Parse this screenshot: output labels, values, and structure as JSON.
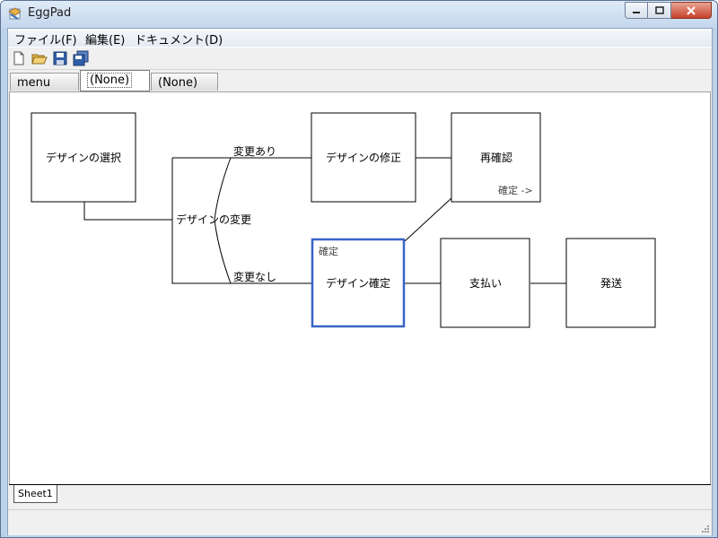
{
  "window": {
    "title": "EggPad"
  },
  "menu": {
    "file": "ファイル(F)",
    "edit": "編集(E)",
    "document": "ドキュメント(D)"
  },
  "tabs": [
    {
      "label": "menu"
    },
    {
      "label": "(None)"
    },
    {
      "label": "(None)"
    }
  ],
  "diagram": {
    "select_design": "デザインの選択",
    "change_design": "デザインの変更",
    "branch_changed": "変更あり",
    "branch_unchanged": "変更なし",
    "fix_design": "デザインの修正",
    "reconfirm": "再確認",
    "confirm_link": "確定 ->",
    "confirm_design_header": "確定",
    "confirm_design": "デザイン確定",
    "payment": "支払い",
    "shipping": "発送"
  },
  "sheet": {
    "tab": "Sheet1"
  },
  "colors": {
    "selection": "#3a63c8"
  }
}
